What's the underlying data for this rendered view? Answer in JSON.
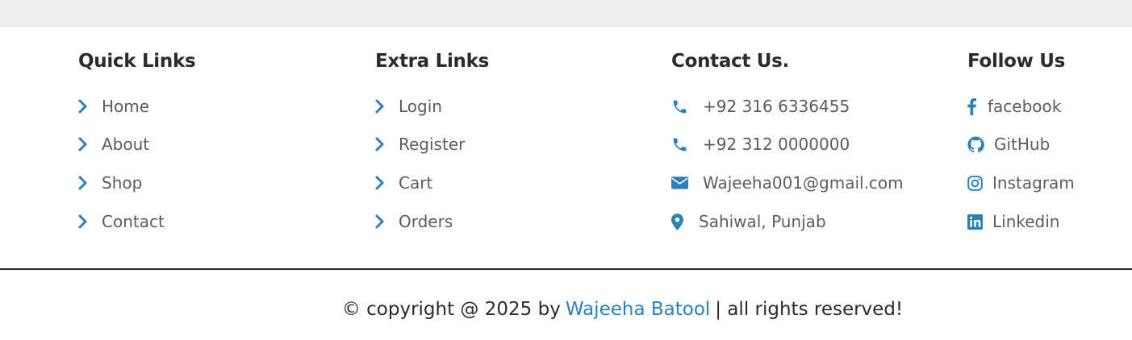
{
  "quick_links": {
    "title": "Quick Links",
    "items": [
      "Home",
      "About",
      "Shop",
      "Contact"
    ]
  },
  "extra_links": {
    "title": "Extra Links",
    "items": [
      "Login",
      "Register",
      "Cart",
      "Orders"
    ]
  },
  "contact": {
    "title": "Contact Us.",
    "items": [
      {
        "icon": "phone-icon",
        "text": "+92 316 6336455"
      },
      {
        "icon": "phone-icon",
        "text": "+92 312 0000000"
      },
      {
        "icon": "envelope-icon",
        "text": "Wajeeha001@gmail.com"
      },
      {
        "icon": "map-pin-icon",
        "text": "Sahiwal, Punjab"
      }
    ]
  },
  "follow": {
    "title": "Follow Us",
    "items": [
      {
        "icon": "facebook-icon",
        "text": "facebook"
      },
      {
        "icon": "github-icon",
        "text": "GitHub"
      },
      {
        "icon": "instagram-icon",
        "text": "Instagram"
      },
      {
        "icon": "linkedin-icon",
        "text": "Linkedin"
      }
    ]
  },
  "credit": {
    "prefix": "© copyright @ 2025 by",
    "author": "Wajeeha Batool",
    "suffix": "| all rights reserved!"
  },
  "colors": {
    "accent": "#2c80b9",
    "heading": "#2b2b2b",
    "link_text": "#5c5c5c",
    "top_band": "#eeeeee"
  }
}
